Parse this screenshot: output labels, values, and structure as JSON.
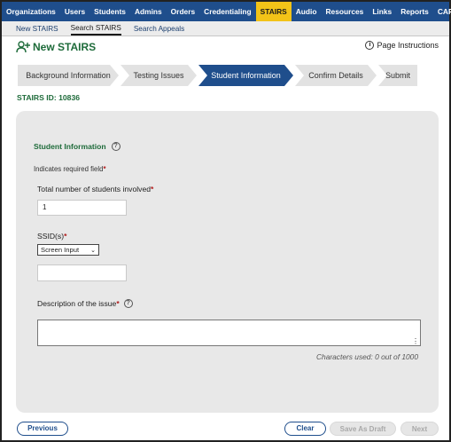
{
  "nav": {
    "items": [
      "Organizations",
      "Users",
      "Students",
      "Admins",
      "Orders",
      "Credentialing",
      "STAIRS",
      "Audio",
      "Resources",
      "Links",
      "Reports",
      "CARS"
    ],
    "active": "STAIRS"
  },
  "subnav": {
    "items": [
      "New STAIRS",
      "Search STAIRS",
      "Search Appeals"
    ],
    "active": "Search STAIRS"
  },
  "page": {
    "title": "New STAIRS",
    "instructions": "Page Instructions",
    "stairs_id": "STAIRS ID: 10836"
  },
  "steps": [
    "Background Information",
    "Testing Issues",
    "Student Information",
    "Confirm Details",
    "Submit"
  ],
  "active_step": "Student Information",
  "form": {
    "section_title": "Student Information",
    "required_note": "Indicates required field",
    "students_label": "Total number of students involved",
    "students_value": "1",
    "ssid_label": "SSID(s)",
    "ssid_select": "Screen Input",
    "ssid_value": "",
    "description_label": "Description of the issue",
    "description_value": "",
    "char_count": "Characters used: 0 out of 1000",
    "required_mark": "*"
  },
  "buttons": {
    "previous": "Previous",
    "clear": "Clear",
    "save_draft": "Save As Draft",
    "next": "Next"
  },
  "colors": {
    "nav_bg": "#1f4e8c",
    "nav_active": "#f2c318",
    "title_green": "#1e6b3a",
    "required_red": "#b01c1c"
  }
}
